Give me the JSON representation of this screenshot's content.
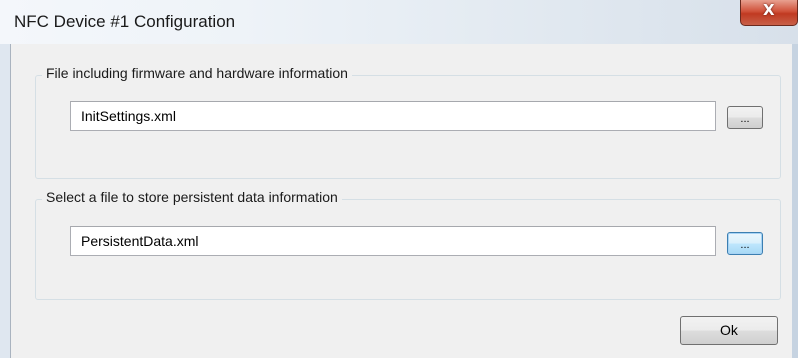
{
  "window": {
    "title": "NFC Device #1 Configuration",
    "close_label": "X"
  },
  "firmware_group": {
    "label": "File including firmware and hardware information",
    "file_value": "InitSettings.xml",
    "browse_label": "..."
  },
  "persistent_group": {
    "label": "Select a file to store persistent data information",
    "file_value": "PersistentData.xml",
    "browse_label": "..."
  },
  "footer": {
    "ok_label": "Ok"
  }
}
